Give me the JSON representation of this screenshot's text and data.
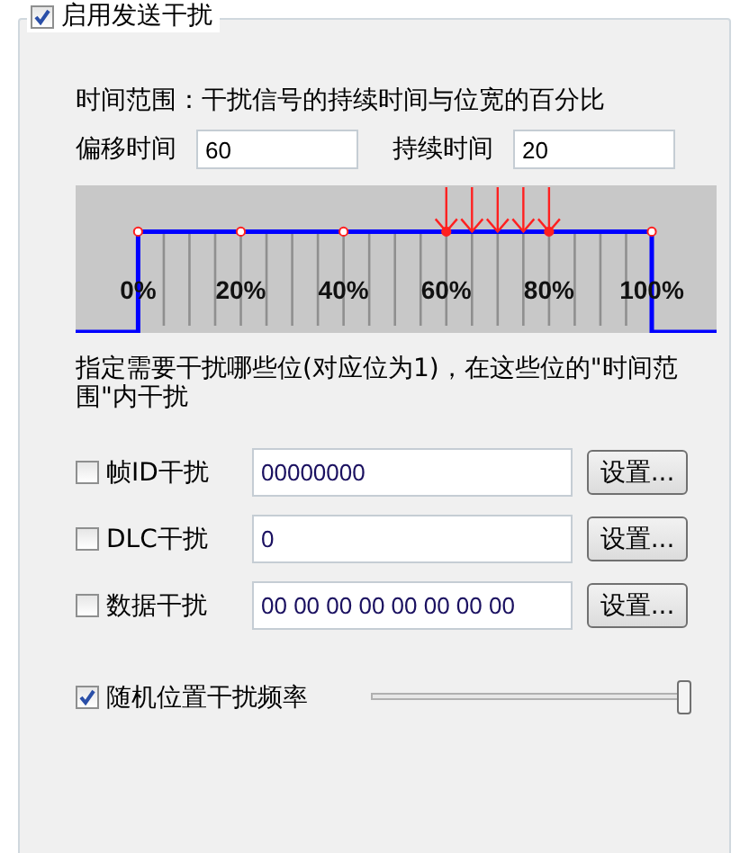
{
  "group": {
    "title": "启用发送干扰",
    "checked": true
  },
  "time_range_label": "时间范围：干扰信号的持续时间与位宽的百分比",
  "time_fields": [
    {
      "label": "偏移时间",
      "value": "60"
    },
    {
      "label": "持续时间",
      "value": "20"
    }
  ],
  "timing_chart": {
    "scale_labels": [
      "0%",
      "20%",
      "40%",
      "60%",
      "80%",
      "100%"
    ]
  },
  "bits_hint": "指定需要干扰哪些位(对应位为1)，在这些位的\"时间范围\"内干扰",
  "targets": [
    {
      "label": "帧ID干扰",
      "checked": false,
      "value": "00000000",
      "button": "设置..."
    },
    {
      "label": "DLC干扰",
      "checked": false,
      "value": "0",
      "button": "设置..."
    },
    {
      "label": "数据干扰",
      "checked": false,
      "value": "00 00 00 00 00 00 00 00",
      "button": "设置..."
    }
  ],
  "random_frequency": {
    "label": "随机位置干扰频率",
    "checked": true,
    "level": 1
  }
}
